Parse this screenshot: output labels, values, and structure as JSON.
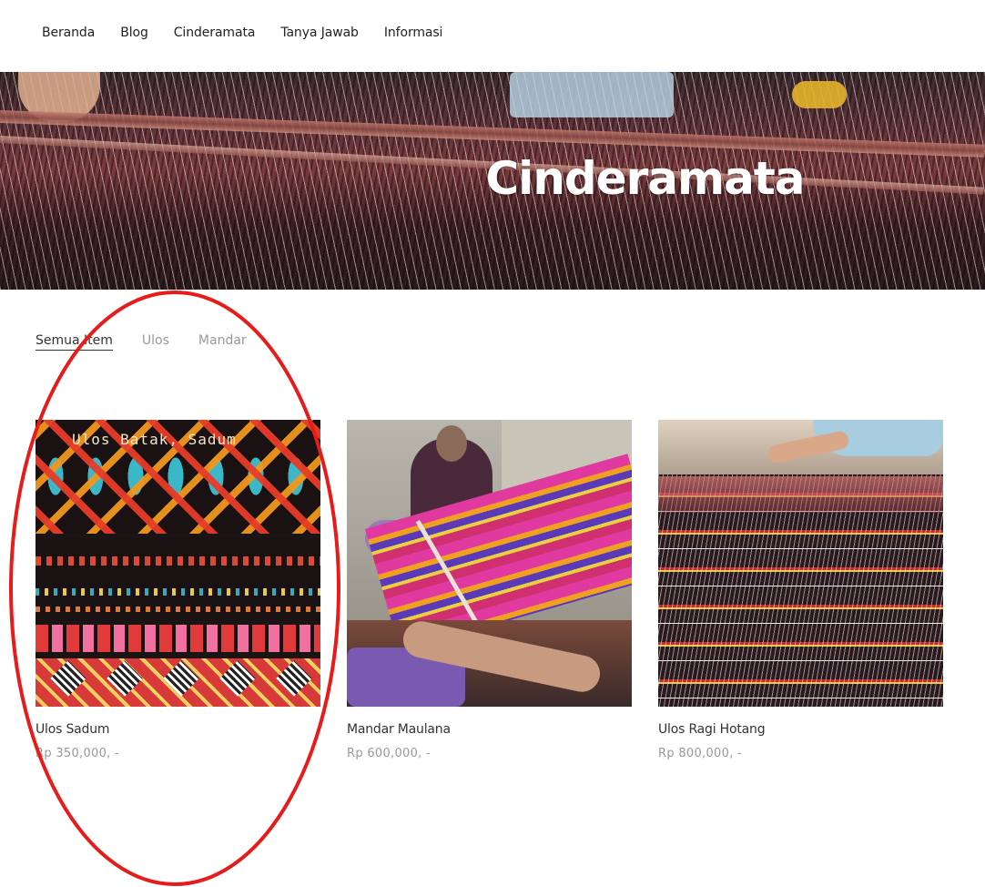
{
  "nav": {
    "items": [
      {
        "label": "Beranda"
      },
      {
        "label": "Blog"
      },
      {
        "label": "Cinderamata"
      },
      {
        "label": "Tanya Jawab"
      },
      {
        "label": "Informasi"
      }
    ]
  },
  "hero": {
    "title": "Cinderamata"
  },
  "filters": {
    "items": [
      {
        "label": "Semua Item",
        "active": true
      },
      {
        "label": "Ulos",
        "active": false
      },
      {
        "label": "Mandar",
        "active": false
      }
    ]
  },
  "products": [
    {
      "name": "Ulos Sadum",
      "price": "Rp 350,000, -",
      "image_text": "Ulos Batak, Sadum"
    },
    {
      "name": "Mandar Maulana",
      "price": "Rp 600,000, -"
    },
    {
      "name": "Ulos Ragi Hotang",
      "price": "Rp 800,000, -"
    }
  ],
  "colors": {
    "annotation": "#e81b1b",
    "text": "#333333",
    "muted": "#999999"
  }
}
